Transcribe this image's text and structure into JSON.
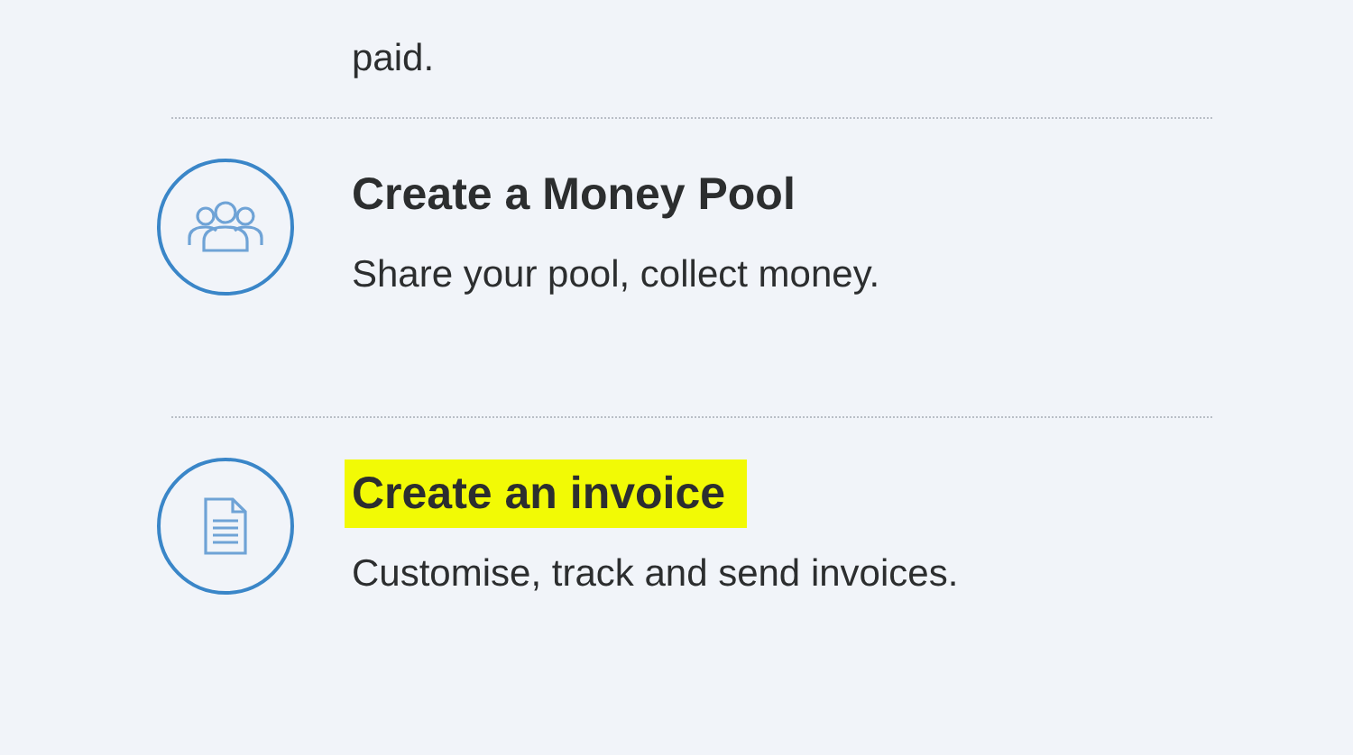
{
  "top_item": {
    "description": "paid."
  },
  "items": [
    {
      "kind": "people",
      "title": "Create a Money Pool",
      "highlighted": false,
      "description": "Share your pool, collect money."
    },
    {
      "kind": "document",
      "title": "Create an invoice",
      "highlighted": true,
      "description": "Customise, track and send invoices."
    }
  ]
}
